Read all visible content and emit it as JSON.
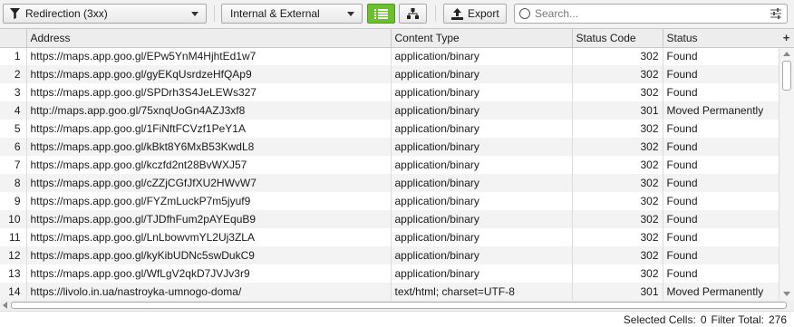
{
  "toolbar": {
    "filter_value": "Redirection (3xx)",
    "scope_value": "Internal & External",
    "export_label": "Export",
    "search_placeholder": "Search..."
  },
  "columns": [
    "Address",
    "Content Type",
    "Status Code",
    "Status"
  ],
  "add_column_label": "+",
  "rows": [
    {
      "n": "1",
      "address": "https://maps.app.goo.gl/EPw5YnM4HjhtEd1w7",
      "content_type": "application/binary",
      "status_code": "302",
      "status": "Found"
    },
    {
      "n": "2",
      "address": "https://maps.app.goo.gl/gyEKqUsrdzeHfQAp9",
      "content_type": "application/binary",
      "status_code": "302",
      "status": "Found"
    },
    {
      "n": "3",
      "address": "https://maps.app.goo.gl/SPDrh3S4JeLEWs327",
      "content_type": "application/binary",
      "status_code": "302",
      "status": "Found"
    },
    {
      "n": "4",
      "address": "http://maps.app.goo.gl/75xnqUoGn4AZJ3xf8",
      "content_type": "application/binary",
      "status_code": "301",
      "status": "Moved Permanently"
    },
    {
      "n": "5",
      "address": "https://maps.app.goo.gl/1FiNftFCVzf1PeY1A",
      "content_type": "application/binary",
      "status_code": "302",
      "status": "Found"
    },
    {
      "n": "6",
      "address": "https://maps.app.goo.gl/kBkt8Y6MxB53KwdL8",
      "content_type": "application/binary",
      "status_code": "302",
      "status": "Found"
    },
    {
      "n": "7",
      "address": "https://maps.app.goo.gl/kczfd2nt28BvWXJ57",
      "content_type": "application/binary",
      "status_code": "302",
      "status": "Found"
    },
    {
      "n": "8",
      "address": "https://maps.app.goo.gl/cZZjCGfJfXU2HWvW7",
      "content_type": "application/binary",
      "status_code": "302",
      "status": "Found"
    },
    {
      "n": "9",
      "address": "https://maps.app.goo.gl/FYZmLuckP7m5jyuf9",
      "content_type": "application/binary",
      "status_code": "302",
      "status": "Found"
    },
    {
      "n": "10",
      "address": "https://maps.app.goo.gl/TJDfhFum2pAYEquB9",
      "content_type": "application/binary",
      "status_code": "302",
      "status": "Found"
    },
    {
      "n": "11",
      "address": "https://maps.app.goo.gl/LnLbowvmYL2Uj3ZLA",
      "content_type": "application/binary",
      "status_code": "302",
      "status": "Found"
    },
    {
      "n": "12",
      "address": "https://maps.app.goo.gl/kyKibUDNc5swDukC9",
      "content_type": "application/binary",
      "status_code": "302",
      "status": "Found"
    },
    {
      "n": "13",
      "address": "https://maps.app.goo.gl/WfLgV2qkD7JVJv3r9",
      "content_type": "application/binary",
      "status_code": "302",
      "status": "Found"
    },
    {
      "n": "14",
      "address": "https://livolo.in.ua/nastroyka-umnogo-doma/",
      "content_type": "text/html; charset=UTF-8",
      "status_code": "301",
      "status": "Moved Permanently"
    }
  ],
  "statusbar": {
    "selected_label": "Selected Cells:",
    "selected_value": "0",
    "filter_label": "Filter Total:",
    "filter_value": "276"
  },
  "colors": {
    "active_view": "#6cbf2e",
    "header_bg": "#ededed",
    "alt_row": "#f3f3f3"
  }
}
